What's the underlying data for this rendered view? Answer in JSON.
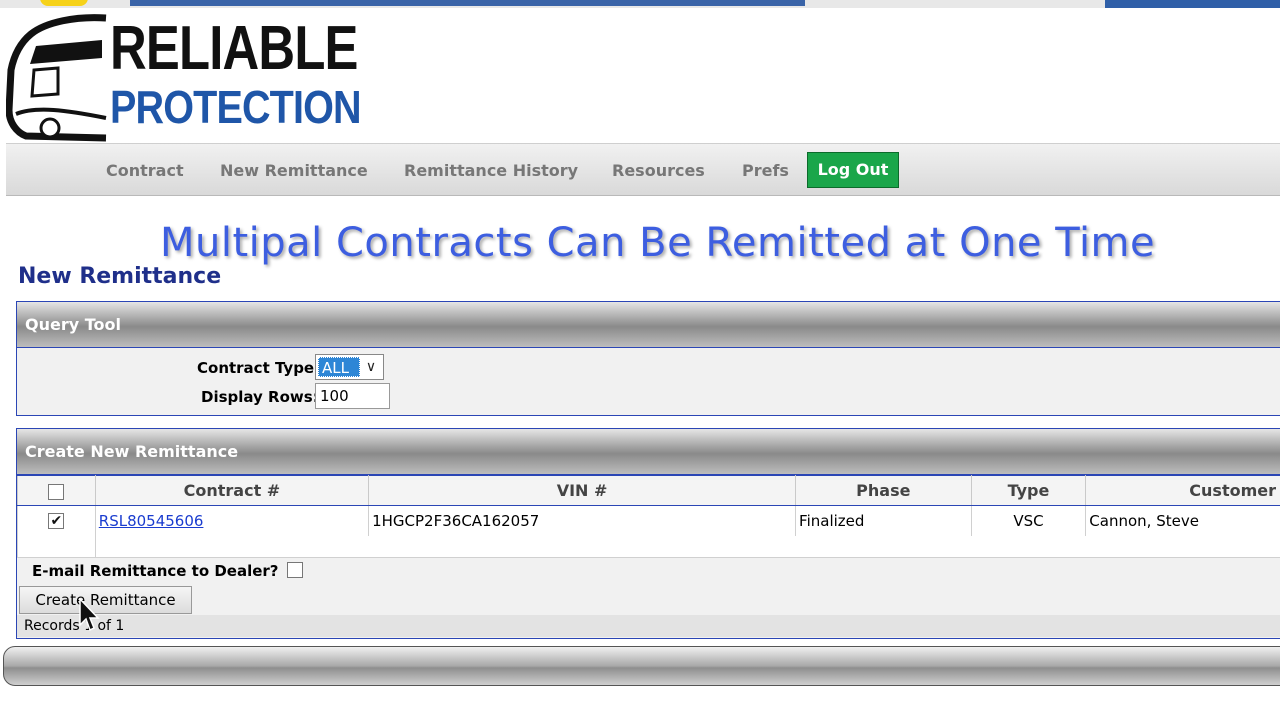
{
  "brand": {
    "line1": "RELIABLE",
    "line2": "PROTECTION"
  },
  "nav": {
    "items": [
      "Contract",
      "New Remittance",
      "Remittance History",
      "Resources",
      "Prefs"
    ],
    "logout": "Log Out"
  },
  "banner": "Multipal Contracts Can Be Remitted at One Time",
  "page_title": "New Remittance",
  "query_tool": {
    "title": "Query Tool",
    "contract_type_label": "Contract Type:",
    "contract_type_value": "ALL",
    "display_rows_label": "Display Rows:",
    "display_rows_value": "100"
  },
  "create": {
    "title": "Create New Remittance",
    "columns": [
      "Contract #",
      "VIN #",
      "Phase",
      "Type",
      "Customer"
    ],
    "rows": [
      {
        "checked": true,
        "contract": "RSL80545606",
        "vin": "1HGCP2F36CA162057",
        "phase": "Finalized",
        "type": "VSC",
        "customer": "Cannon, Steve"
      }
    ],
    "email_label": "E-mail Remittance to Dealer?",
    "button": "Create Remittance",
    "records": "Records 1 of 1"
  },
  "colors": {
    "accent": "#1f2f8a",
    "logout": "#1aa64a",
    "banner": "#3d5ee0",
    "link": "#1a3ccf"
  }
}
